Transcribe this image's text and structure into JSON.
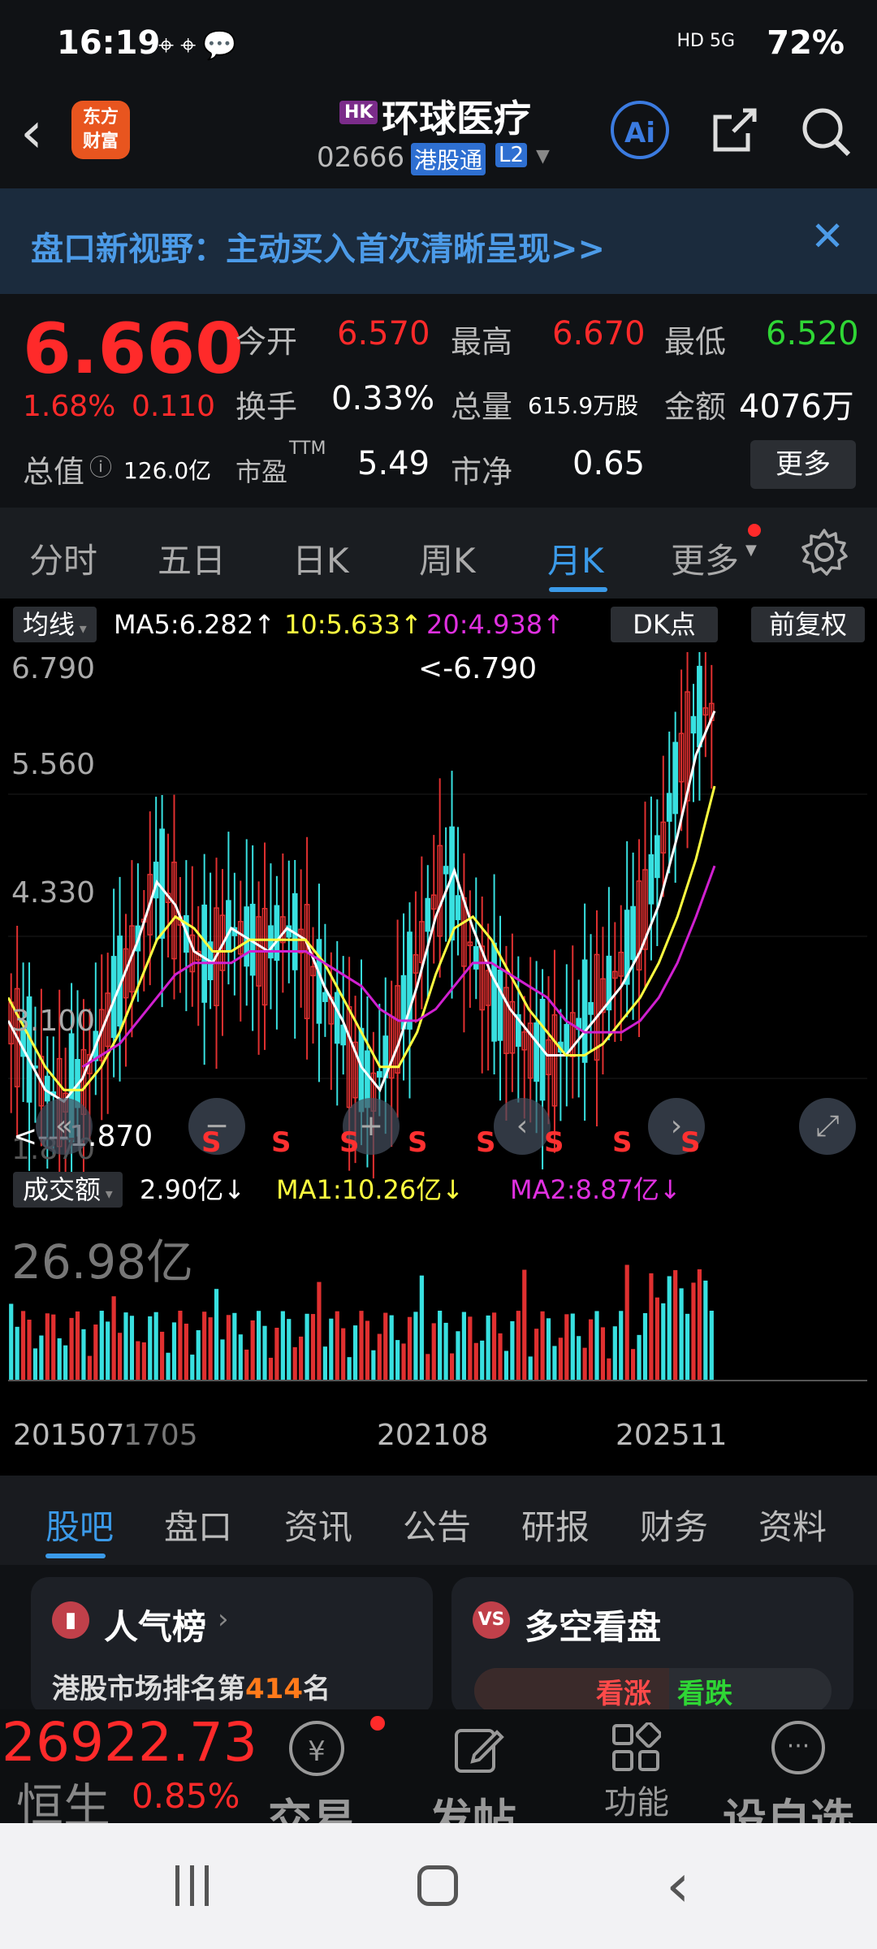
{
  "status_bar": {
    "time": "16:19",
    "signal": "HD 5G",
    "battery": "72%"
  },
  "header": {
    "market_badge": "HK",
    "stock_name": "环球医疗",
    "stock_code": "02666",
    "channel_badge": "港股通",
    "level_badge": "L2",
    "logo_text_1": "东方",
    "logo_text_2": "财富",
    "ai_label": "Ai"
  },
  "banner": {
    "text": "盘口新视野：主动买入首次清晰呈现>>"
  },
  "quote": {
    "price": "6.660",
    "change_pct": "1.68%",
    "change_abs": "0.110",
    "open_label": "今开",
    "open": "6.570",
    "high_label": "最高",
    "high": "6.670",
    "low_label": "最低",
    "low": "6.520",
    "turnover_label": "换手",
    "turnover": "0.33%",
    "volume_label": "总量",
    "volume": "615.9万股",
    "amount_label": "金额",
    "amount": "4076万",
    "mktcap_label": "总值",
    "mktcap": "126.0亿",
    "pe_label": "市盈",
    "pe_sup": "TTM",
    "pe": "5.49",
    "pb_label": "市净",
    "pb": "0.65",
    "more_label": "更多"
  },
  "tabs": [
    {
      "label": "分时"
    },
    {
      "label": "五日"
    },
    {
      "label": "日K"
    },
    {
      "label": "周K"
    },
    {
      "label": "月K"
    },
    {
      "label": "更多"
    }
  ],
  "chart_header": {
    "ma_label": "均线",
    "ma5": "MA5:6.282",
    "ma10": "10:5.633",
    "ma20": "20:4.938",
    "dk_label": "DK点",
    "fq_label": "前复权"
  },
  "chart_axis": {
    "y_top": "6.790",
    "y2": "5.560",
    "y3": "4.330",
    "y4": "3.100",
    "y_bottom": "1.870",
    "max_marker": "<-6.790",
    "min_marker": "<---1.870"
  },
  "volume_header": {
    "label": "成交额",
    "value": "2.90亿",
    "ma1": "MA1:10.26亿",
    "ma2": "MA2:8.87亿",
    "max": "26.98亿"
  },
  "x_axis": {
    "labels": [
      "201507",
      "1705",
      "202108",
      "202511"
    ]
  },
  "s_mark": "S",
  "subtabs": [
    {
      "label": "股吧"
    },
    {
      "label": "盘口"
    },
    {
      "label": "资讯"
    },
    {
      "label": "公告"
    },
    {
      "label": "研报"
    },
    {
      "label": "财务"
    },
    {
      "label": "资料"
    }
  ],
  "cards": {
    "left_title": "人气榜",
    "left_text_pre": "港股市场排名第",
    "left_rank": "414",
    "left_text_post": "名",
    "right_title": "多空看盘",
    "right_up": "看涨",
    "right_down": "看跌"
  },
  "bottom_nav": {
    "index_value": "26922.73",
    "index_name": "恒生",
    "index_pct": "0.85%",
    "trade": "交易",
    "post": "发帖",
    "func": "功能",
    "watch": "设自选"
  },
  "colors": {
    "up": "#ff2a2a",
    "down": "#2fd635",
    "accent": "#3b9ae8",
    "candle_up": "#e03030",
    "candle_down": "#38e0e0",
    "ma5": "#ffffff",
    "ma10": "#ffff40",
    "ma20": "#d020d0"
  },
  "chart_data": {
    "type": "candlestick",
    "ylim": [
      1.87,
      6.79
    ],
    "x_labels": [
      "201507",
      "1705",
      "202108",
      "202511"
    ],
    "ma5_last": 6.282,
    "ma10_last": 5.633,
    "ma20_last": 4.938,
    "close_last": 6.66,
    "high_max": 6.79,
    "low_min": 1.87,
    "series": [
      {
        "name": "MA5",
        "values": [
          3.6,
          3.3,
          3.0,
          2.9,
          3.1,
          3.5,
          3.9,
          4.3,
          4.8,
          4.6,
          4.2,
          4.1,
          4.4,
          4.3,
          4.2,
          4.4,
          4.3,
          3.9,
          3.6,
          3.2,
          3.0,
          3.4,
          3.9,
          4.5,
          4.9,
          4.4,
          4.0,
          3.7,
          3.5,
          3.3,
          3.3,
          3.5,
          3.7,
          3.9,
          4.2,
          4.6,
          5.2,
          5.9,
          6.28
        ]
      },
      {
        "name": "MA10",
        "values": [
          3.8,
          3.5,
          3.2,
          3.0,
          3.0,
          3.2,
          3.5,
          3.9,
          4.3,
          4.5,
          4.4,
          4.2,
          4.2,
          4.3,
          4.3,
          4.3,
          4.3,
          4.1,
          3.8,
          3.5,
          3.2,
          3.2,
          3.5,
          4.0,
          4.4,
          4.5,
          4.3,
          4.0,
          3.7,
          3.5,
          3.3,
          3.3,
          3.4,
          3.6,
          3.8,
          4.1,
          4.5,
          5.0,
          5.63
        ]
      },
      {
        "name": "MA20",
        "values": [
          null,
          null,
          null,
          null,
          3.2,
          3.3,
          3.4,
          3.6,
          3.8,
          4.0,
          4.1,
          4.1,
          4.1,
          4.2,
          4.2,
          4.2,
          4.2,
          4.1,
          4.0,
          3.9,
          3.7,
          3.6,
          3.6,
          3.7,
          3.9,
          4.1,
          4.1,
          4.0,
          3.9,
          3.8,
          3.6,
          3.5,
          3.5,
          3.5,
          3.6,
          3.8,
          4.1,
          4.5,
          4.94
        ]
      }
    ]
  }
}
